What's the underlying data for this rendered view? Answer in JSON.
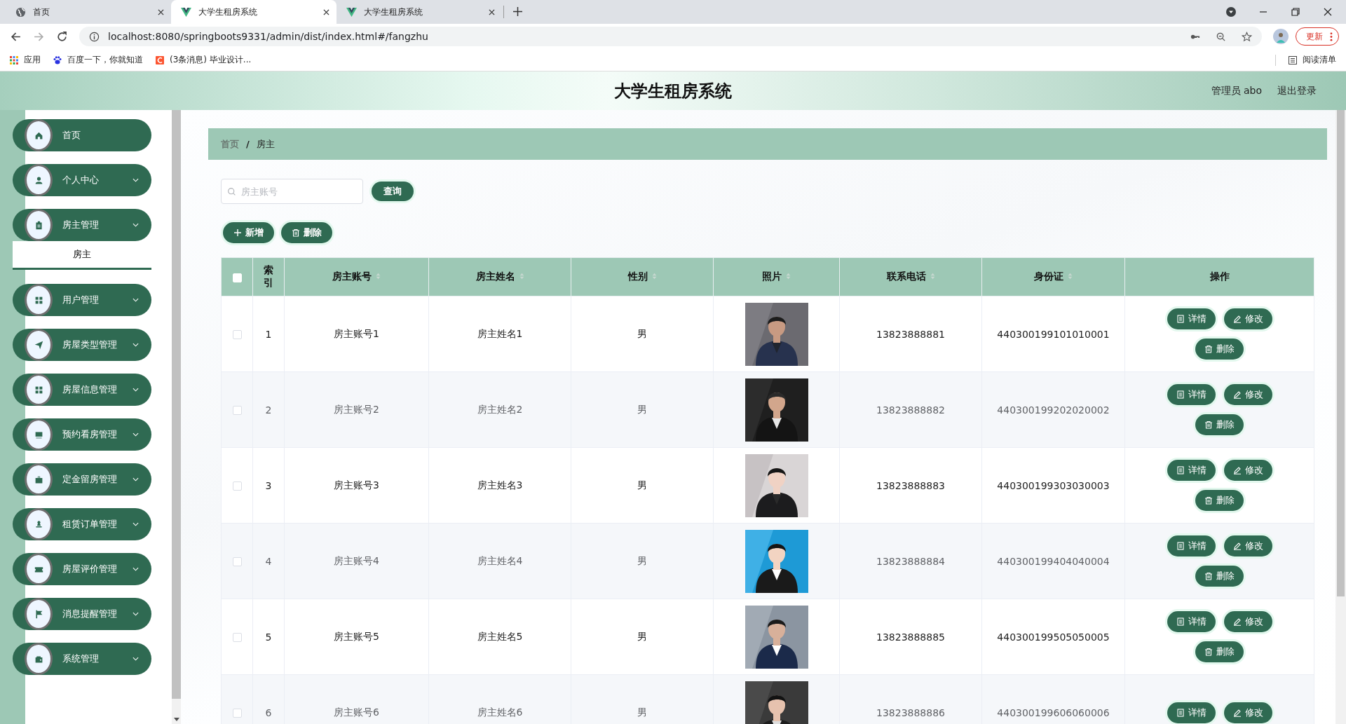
{
  "browser": {
    "tabs": [
      {
        "title": "首页",
        "selected": false
      },
      {
        "title": "大学生租房系统",
        "selected": true
      },
      {
        "title": "大学生租房系统",
        "selected": false
      }
    ],
    "url": "localhost:8080/springboots9331/admin/dist/index.html#/fangzhu",
    "update_button": "更新",
    "bookmarks": [
      "应用",
      "百度一下，你就知道",
      "(3条消息) 毕业设计..."
    ],
    "reading_list": "阅读清单"
  },
  "header": {
    "title": "大学生租房系统",
    "user": "管理员 abo",
    "logout": "退出登录"
  },
  "sidebar": {
    "items": [
      {
        "label": "首页",
        "kind": "link"
      },
      {
        "label": "个人中心",
        "kind": "submenu"
      },
      {
        "label": "房主管理",
        "kind": "submenu",
        "children": [
          {
            "label": "房主",
            "selected": true
          }
        ]
      },
      {
        "label": "用户管理",
        "kind": "submenu"
      },
      {
        "label": "房屋类型管理",
        "kind": "submenu"
      },
      {
        "label": "房屋信息管理",
        "kind": "submenu"
      },
      {
        "label": "预约看房管理",
        "kind": "submenu"
      },
      {
        "label": "定金留房管理",
        "kind": "submenu"
      },
      {
        "label": "租赁订单管理",
        "kind": "submenu"
      },
      {
        "label": "房屋评价管理",
        "kind": "submenu"
      },
      {
        "label": "消息提醒管理",
        "kind": "submenu"
      },
      {
        "label": "系统管理",
        "kind": "submenu"
      }
    ]
  },
  "breadcrumb": {
    "items": [
      "首页",
      "房主"
    ],
    "separator": "/"
  },
  "search": {
    "placeholder": "房主账号",
    "button": "查询"
  },
  "actions": [
    {
      "label": "新增",
      "kind": "add"
    },
    {
      "label": "删除",
      "kind": "delete"
    }
  ],
  "table": {
    "select_all": {
      "checked": false
    },
    "columns": [
      {
        "label": "索引",
        "sortable": false
      },
      {
        "label": "房主账号",
        "sortable": true
      },
      {
        "label": "房主姓名",
        "sortable": true
      },
      {
        "label": "性别",
        "sortable": true
      },
      {
        "label": "照片",
        "sortable": true
      },
      {
        "label": "联系电话",
        "sortable": true
      },
      {
        "label": "身份证",
        "sortable": true
      },
      {
        "label": "操作",
        "sortable": false
      }
    ],
    "rows": [
      {
        "checked": false,
        "index": "1",
        "account": "房主账号1",
        "name": "房主姓名1",
        "gender": "男",
        "phone": "13823888881",
        "id_card": "440300199101010001",
        "actions": [
          {
            "label": "详情",
            "kind": "detail"
          },
          {
            "label": "修改",
            "kind": "edit"
          },
          {
            "label": "删除",
            "kind": "delete"
          }
        ]
      },
      {
        "checked": false,
        "index": "2",
        "account": "房主账号2",
        "name": "房主姓名2",
        "gender": "男",
        "phone": "13823888882",
        "id_card": "440300199202020002",
        "actions": [
          {
            "label": "详情",
            "kind": "detail"
          },
          {
            "label": "修改",
            "kind": "edit"
          },
          {
            "label": "删除",
            "kind": "delete"
          }
        ]
      },
      {
        "checked": false,
        "index": "3",
        "account": "房主账号3",
        "name": "房主姓名3",
        "gender": "男",
        "phone": "13823888883",
        "id_card": "440300199303030003",
        "actions": [
          {
            "label": "详情",
            "kind": "detail"
          },
          {
            "label": "修改",
            "kind": "edit"
          },
          {
            "label": "删除",
            "kind": "delete"
          }
        ]
      },
      {
        "checked": false,
        "index": "4",
        "account": "房主账号4",
        "name": "房主姓名4",
        "gender": "男",
        "phone": "13823888884",
        "id_card": "440300199404040004",
        "actions": [
          {
            "label": "详情",
            "kind": "detail"
          },
          {
            "label": "修改",
            "kind": "edit"
          },
          {
            "label": "删除",
            "kind": "delete"
          }
        ]
      },
      {
        "checked": false,
        "index": "5",
        "account": "房主账号5",
        "name": "房主姓名5",
        "gender": "男",
        "phone": "13823888885",
        "id_card": "440300199505050005",
        "actions": [
          {
            "label": "详情",
            "kind": "detail"
          },
          {
            "label": "修改",
            "kind": "edit"
          },
          {
            "label": "删除",
            "kind": "delete"
          }
        ]
      },
      {
        "checked": false,
        "index": "6",
        "account": "房主账号6",
        "name": "房主姓名6",
        "gender": "男",
        "phone": "13823888886",
        "id_card": "440300199606060006",
        "actions": [
          {
            "label": "详情",
            "kind": "detail"
          },
          {
            "label": "修改",
            "kind": "edit"
          }
        ]
      }
    ]
  }
}
